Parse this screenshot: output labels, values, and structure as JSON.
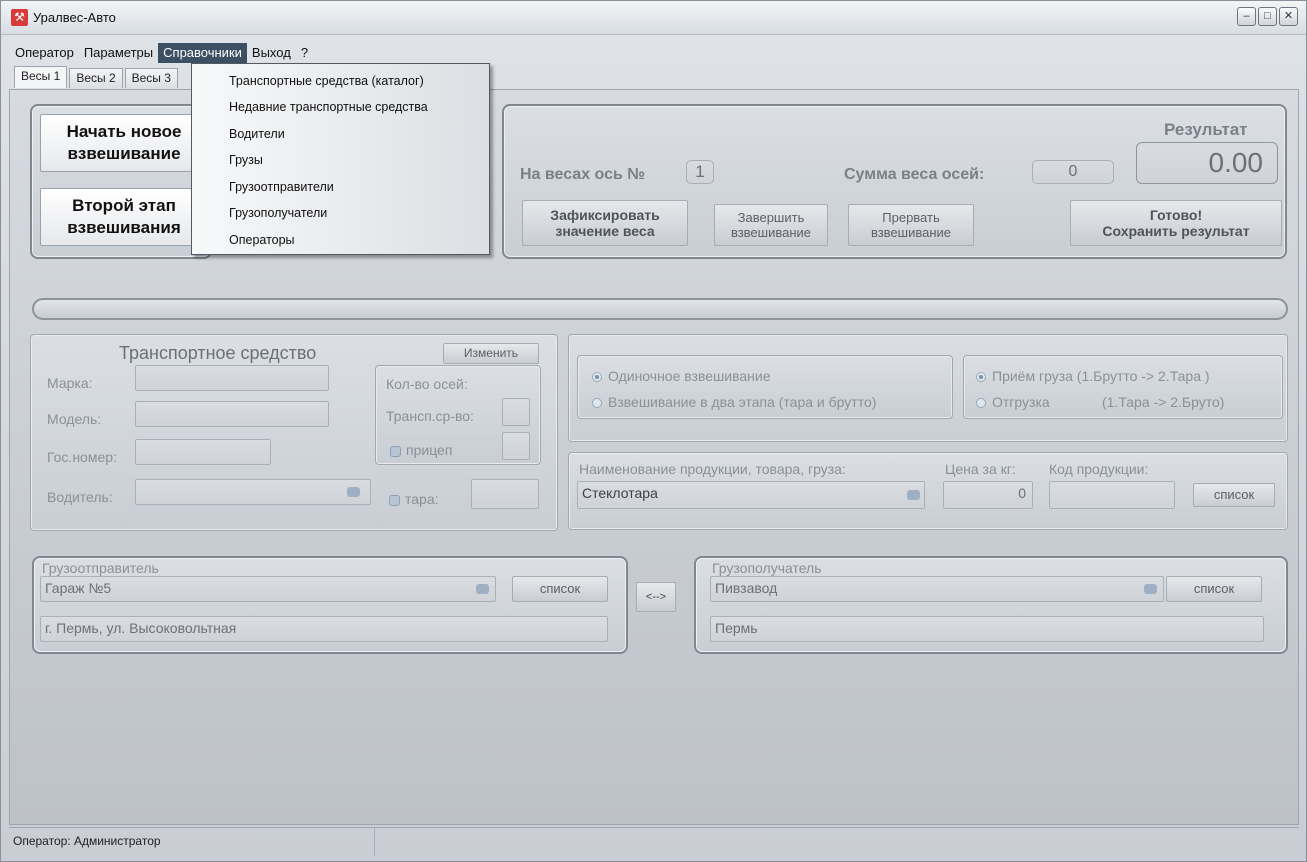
{
  "window": {
    "title": "Уралвес-Авто"
  },
  "menu": [
    "Оператор",
    "Параметры",
    "Справочники",
    "Выход",
    "?"
  ],
  "tabs": [
    "Весы 1",
    "Весы 2",
    "Весы 3"
  ],
  "dropdown_items": [
    "Транспортные средства (каталог)",
    "Недавние транспортные средства",
    "Водители",
    "Грузы",
    "Грузоотправители",
    "Грузополучатели",
    "Операторы"
  ],
  "weighing": {
    "start_line1": "Начать новое",
    "start_line2": "взвешивание",
    "second_line1": "Второй этап",
    "second_line2": "взвешивания",
    "axle_label": "На весах ось №",
    "axle_value": "1",
    "sum_label": "Сумма веса осей:",
    "sum_value": "0",
    "result_label": "Результат",
    "result_value": "0.00",
    "fix_line1": "Зафиксировать",
    "fix_line2": "значение веса",
    "finish_line1": "Завершить",
    "finish_line2": "взвешивание",
    "abort_line1": "Прервать",
    "abort_line2": "взвешивание",
    "save_line1": "Готово!",
    "save_line2": "Сохранить результат"
  },
  "vehicle": {
    "title": "Транспортное средство",
    "edit_button": "Изменить",
    "brand_label": "Марка:",
    "model_label": "Модель:",
    "plate_label": "Гос.номер:",
    "driver_label": "Водитель:",
    "axles_title": "Кол-во осей:",
    "vehicle_axles_label": "Трансп.ср-во:",
    "trailer_label": "прицеп",
    "tare_label": "тара:"
  },
  "mode": {
    "single": "Одиночное взвешивание",
    "two_stage": "Взвешивание в два этапа (тара и брутто)",
    "receive": "Приём груза  (1.Брутто -> 2.Тара )",
    "ship": "Отгрузка",
    "ship_order": "(1.Тара   -> 2.Бруто)"
  },
  "product": {
    "name_label": "Наименование продукции, товара, груза:",
    "name_value": "Стеклотара",
    "price_label": "Цена за кг:",
    "price_value": "0",
    "code_label": "Код продукции:",
    "list_button": "список"
  },
  "sender": {
    "title": "Грузоотправитель",
    "name": "Гараж №5",
    "address": "г. Пермь, ул. Высоковольтная",
    "list_button": "список"
  },
  "swap_button": "<-->",
  "receiver": {
    "title": "Грузополучатель",
    "name": "Пивзавод",
    "address": "Пермь",
    "list_button": "список"
  },
  "status": {
    "operator": "Оператор: Администратор"
  }
}
